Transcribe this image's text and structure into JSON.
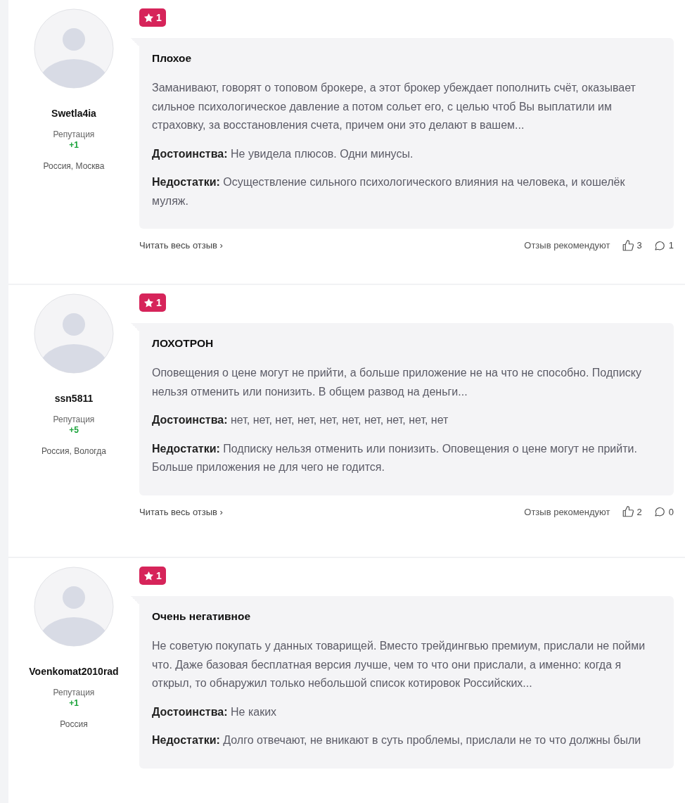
{
  "reviews": [
    {
      "author": "Swetla4ia",
      "reputation_label": "Репутация",
      "reputation": "+1",
      "location": "Россия, Москва",
      "rating": "1",
      "title": "Плохое",
      "body": "Заманивают, говорят о топовом брокере, а этот брокер убеждает пополнить счёт, оказывает сильное психологическое давление а потом сольет его, с целью чтоб Вы выплатили им страховку, за восстановления счета, причем они это делают в вашем...",
      "pros_label": "Достоинства:",
      "pros": "Не увидела плюсов. Одни минусы.",
      "cons_label": "Недостатки:",
      "cons": "Осуществление сильного психологического влияния на человека, и кошелёк муляж.",
      "read_more": "Читать весь отзыв",
      "chevron": "›",
      "recommend_label": "Отзыв рекомендуют",
      "likes": "3",
      "comments": "1"
    },
    {
      "author": "ssn5811",
      "reputation_label": "Репутация",
      "reputation": "+5",
      "location": "Россия, Вологда",
      "rating": "1",
      "title": "ЛОХОТРОН",
      "body": "Оповещения о цене могут не прийти, а больше приложение не на что не способно. Подписку нельзя отменить или понизить. В общем развод на деньги...",
      "pros_label": "Достоинства:",
      "pros": "нет, нет, нет, нет, нет, нет, нет, нет, нет, нет",
      "cons_label": "Недостатки:",
      "cons": "Подписку нельзя отменить или понизить. Оповещения о цене могут не прийти. Больше приложения не для чего не годится.",
      "read_more": "Читать весь отзыв",
      "chevron": "›",
      "recommend_label": "Отзыв рекомендуют",
      "likes": "2",
      "comments": "0"
    },
    {
      "author": "Voenkomat2010rad",
      "reputation_label": "Репутация",
      "reputation": "+1",
      "location": "Россия",
      "rating": "1",
      "title": "Очень негативное",
      "body": "Не советую покупать у данных товарищей. Вместо трейдингвью премиум, прислали не пойми что. Даже базовая бесплатная версия лучше, чем то что они прислали, а именно: когда я открыл, то обнаружил только небольшой список котировок Российских...",
      "pros_label": "Достоинства:",
      "pros": "Не каких",
      "cons_label": "Недостатки:",
      "cons": "Долго отвечают, не вникают в суть проблемы, прислали не то что должны были"
    }
  ]
}
